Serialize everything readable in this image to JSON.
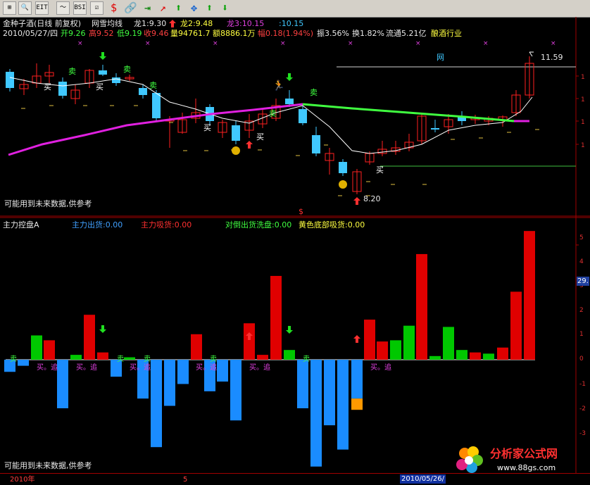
{
  "toolbar": {
    "buttons": [
      "⊞",
      "🔍",
      "EIT",
      "〜",
      "BSI",
      "☑",
      "$",
      "🔗",
      "⇥",
      "↗",
      "⬆",
      "✥",
      "⬆",
      "⬇"
    ],
    "button_names": [
      "grid-icon",
      "zoom-icon",
      "eit-icon",
      "wave-icon",
      "bsi-icon",
      "check-icon",
      "dollar-icon",
      "link-icon",
      "export-icon",
      "draw-line-icon",
      "up-arrow-icon",
      "pan-icon",
      "green-up-arrow-icon",
      "green-down-arrow-icon"
    ]
  },
  "main": {
    "title": "金种子酒(日线 前复权)",
    "indicator": "网雪均线",
    "dragon1": "龙1:9.30",
    "dragon2": "龙2:9.48",
    "dragon3": "龙3:10.15",
    "extra": ":10.15",
    "date": "2010/05/27/四",
    "open": "开9.26",
    "high": "高9.52",
    "low": "低9.19",
    "close": "收9.46",
    "volume": "量94761.7",
    "amount": "额8886.1万",
    "change": "幅0.18(1.94%)",
    "amplitude": "振3.56%",
    "turnover": "换1.82%",
    "float": "流通5.21亿",
    "industry": "酿酒行业",
    "max_price": "11.59",
    "min_price": "8.20",
    "net_label": "网",
    "footer_note": "可能用到未来数据,供参考"
  },
  "lower": {
    "title": "主力控盘A",
    "out": "主力出货:0.00",
    "absorb": "主力吸货:0.00",
    "wash": "对倒出货洗盘:0.00",
    "yellow": "黄色底部吸货:0.00",
    "footer_note": "可能用到未来数据,供参考",
    "y_labels": [
      "5",
      "4",
      "3",
      "2",
      "1",
      "0",
      "-1",
      "-2",
      "-3"
    ],
    "y_marker": "29."
  },
  "signals": {
    "buy": "买",
    "sell": "卖",
    "buy_chase": "买。追",
    "dollar": "$"
  },
  "statusbar": {
    "year": "2010年",
    "month": "5",
    "cursor_date": "2010/05/26/"
  },
  "logo": {
    "text": "分析家公式网",
    "url": "www.88gs.com"
  },
  "colors": {
    "up": "#ff2020",
    "down": "#40c8ff",
    "ma_fast": "#ffffff",
    "ma_slow_pink": "#e020e0",
    "ma_slow_green": "#40ff40",
    "bar_blue": "#1a8cff",
    "bar_red": "#e00000",
    "bar_green": "#00c800",
    "bar_orange": "#ff9900"
  }
}
